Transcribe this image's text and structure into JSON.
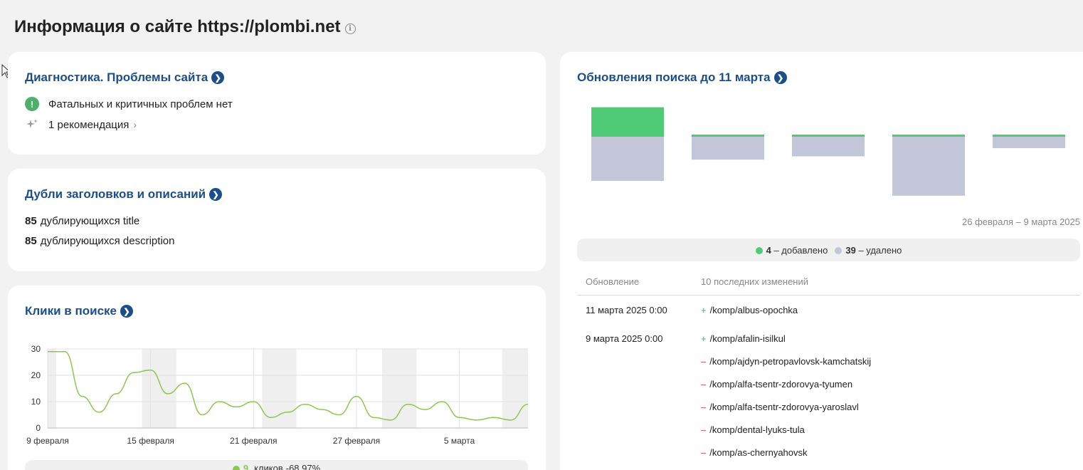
{
  "page": {
    "title": "Информация о сайте https://plombi.net",
    "info_icon": "i"
  },
  "diagnostics": {
    "title": "Диагностика. Проблемы сайта",
    "ok_text": "Фатальных и критичных проблем нет",
    "ok_icon": "!",
    "recommendation": "1 рекомендация",
    "colors": {
      "ok": "#4caf6a"
    }
  },
  "duplicates": {
    "title": "Дубли заголовков и описаний",
    "title_count": "85",
    "title_text": "дублирующихся title",
    "desc_count": "85",
    "desc_text": "дублирующихся description"
  },
  "clicks": {
    "title": "Клики в поиске",
    "legend_value": "9",
    "legend_text": "кликов",
    "legend_change": "-68,97%"
  },
  "updates": {
    "title": "Обновления поиска до 11 марта",
    "range": "26 февраля – 9 марта 2025",
    "added_count": "4",
    "added_text": "– добавлено",
    "removed_count": "39",
    "removed_text": "– удалено",
    "col_update": "Обновление",
    "col_changes": "10 последних изменений",
    "plus_sign": "+",
    "minus_sign": "–",
    "rows": [
      {
        "date": "11 марта 2025 0:00",
        "sign": "+",
        "path": "/komp/albus-opochka"
      },
      {
        "date": "9 марта 2025 0:00",
        "sign": "+",
        "path": "/komp/afalin-isilkul"
      },
      {
        "date": "",
        "sign": "–",
        "path": "/komp/ajdyn-petropavlovsk-kamchatskij"
      },
      {
        "date": "",
        "sign": "–",
        "path": "/komp/alfa-tsentr-zdorovya-tyumen"
      },
      {
        "date": "",
        "sign": "–",
        "path": "/komp/alfa-tsentr-zdorovya-yaroslavl"
      },
      {
        "date": "",
        "sign": "–",
        "path": "/komp/dental-lyuks-tula"
      },
      {
        "date": "",
        "sign": "–",
        "path": "/komp/as-chernyahovsk"
      }
    ],
    "colors": {
      "added": "#4fcb78",
      "removed": "#c3c6d8"
    }
  },
  "chart_data": [
    {
      "type": "line",
      "x_ticks": [
        "9 февраля",
        "15 февраля",
        "21 февраля",
        "27 февраля",
        "5 марта"
      ],
      "x": [
        0,
        1,
        2,
        3,
        4,
        5,
        6,
        7,
        8,
        9,
        10,
        11,
        12,
        13,
        14,
        15,
        16,
        17,
        18,
        19,
        20,
        21,
        22,
        23,
        24,
        25,
        26,
        27
      ],
      "series": [
        {
          "values": [
            29,
            29,
            12,
            6,
            13,
            21,
            22,
            13,
            17,
            5,
            10,
            8,
            10,
            4,
            6,
            9,
            7,
            5,
            12,
            4,
            3,
            9,
            7,
            10,
            4,
            3,
            4,
            3,
            9
          ]
        }
      ],
      "ylim": [
        0,
        30
      ],
      "y_ticks": [
        0,
        10,
        20,
        30
      ],
      "grid": true,
      "color": "#8cc850",
      "weekend_bands": [
        [
          0,
          0.5
        ],
        [
          5.5,
          7.5
        ],
        [
          12.5,
          14.5
        ],
        [
          19.5,
          21.5
        ],
        [
          26.5,
          28
        ]
      ]
    },
    {
      "type": "bar",
      "categories": [
        "1",
        "2",
        "3",
        "4",
        "5"
      ],
      "series": [
        {
          "values": [
            18,
            1,
            1,
            1,
            1
          ]
        },
        {
          "values": [
            27,
            14,
            12,
            36,
            7
          ]
        }
      ]
    }
  ]
}
